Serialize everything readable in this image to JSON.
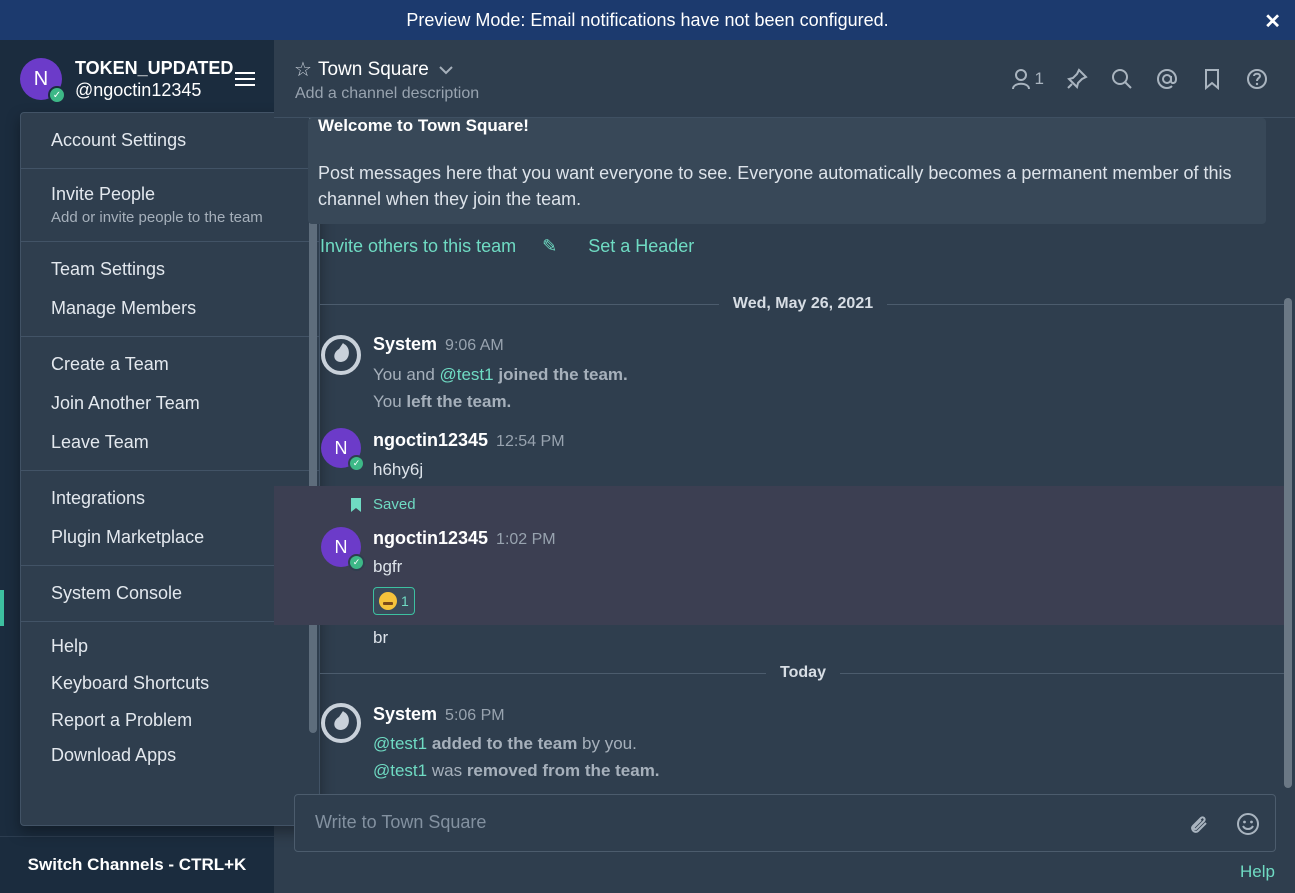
{
  "banner": {
    "text": "Preview Mode: Email notifications have not been configured.",
    "close": "✕"
  },
  "sidebar": {
    "avatar_letter": "N",
    "team_name": "TOKEN_UPDATED",
    "username": "@ngoctin12345",
    "switch_channels": "Switch Channels - CTRL+K"
  },
  "menu": {
    "account_settings": "Account Settings",
    "invite_people": "Invite People",
    "invite_people_sub": "Add or invite people to the team",
    "team_settings": "Team Settings",
    "manage_members": "Manage Members",
    "create_team": "Create a Team",
    "join_team": "Join Another Team",
    "leave_team": "Leave Team",
    "integrations": "Integrations",
    "plugin_marketplace": "Plugin Marketplace",
    "system_console": "System Console",
    "help": "Help",
    "keyboard_shortcuts": "Keyboard Shortcuts",
    "report_problem": "Report a Problem",
    "download_apps": "Download Apps"
  },
  "channel": {
    "name": "Town Square",
    "description": "Add a channel description",
    "member_count": "1"
  },
  "intro": {
    "title": "Welcome to Town Square!",
    "text": "Post messages here that you want everyone to see. Everyone automatically becomes a permanent member of this channel when they join the team.",
    "invite_link": "Invite others to this team",
    "header_link": "Set a Header"
  },
  "dates": {
    "first": "Wed, May 26, 2021",
    "today": "Today"
  },
  "posts": {
    "p1": {
      "name": "System",
      "time": "9:06 AM",
      "l1_a": "You and ",
      "l1_mention": "@test1",
      "l1_b": " joined the team.",
      "l2_a": "You ",
      "l2_b": "left the team."
    },
    "p2": {
      "name": "ngoctin12345",
      "time": "12:54 PM",
      "text": "h6hy6j"
    },
    "p3": {
      "saved": "Saved",
      "name": "ngoctin12345",
      "time": "1:02 PM",
      "text": "bgfr",
      "reaction_count": "1",
      "followup": "br"
    },
    "p4": {
      "name": "System",
      "time": "5:06 PM",
      "l1_mention": "@test1",
      "l1_a": " added to the team",
      "l1_b": " by you.",
      "l2_mention": "@test1",
      "l2_a": " was ",
      "l2_b": "removed from the team."
    }
  },
  "composer": {
    "placeholder": "Write to Town Square"
  },
  "footer": {
    "help": "Help"
  }
}
